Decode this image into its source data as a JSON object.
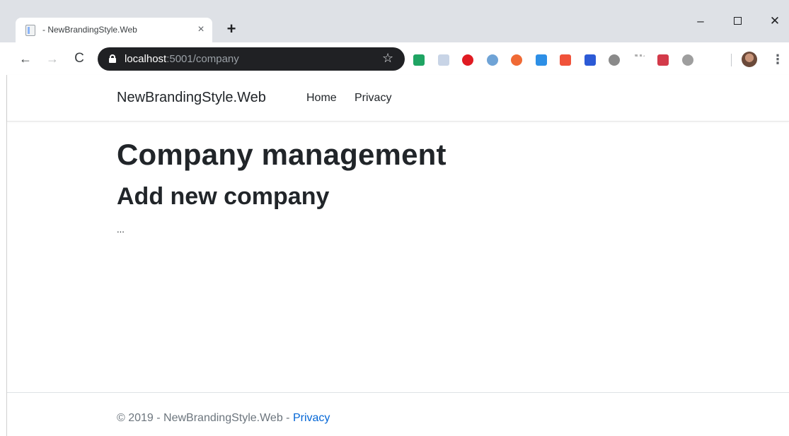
{
  "browser": {
    "tab": {
      "title": "- NewBrandingStyle.Web",
      "close_glyph": "×"
    },
    "new_tab_glyph": "+",
    "window": {
      "minimize_glyph": "–",
      "close_glyph": "✕"
    },
    "nav": {
      "back_glyph": "←",
      "forward_glyph": "→",
      "reload_glyph": "C"
    },
    "address": {
      "host": "localhost",
      "rest": ":5001/company"
    },
    "star_glyph": "☆",
    "menu_glyph": "⋮",
    "extensions": [
      {
        "name": "google-drive-icon",
        "color": "#1fa463"
      },
      {
        "name": "react-devtools-icon",
        "color": "#c8d4e6"
      },
      {
        "name": "opera-icon",
        "color": "#e01b22"
      },
      {
        "name": "edge-icon",
        "color": "#6fa3d6"
      },
      {
        "name": "ublock-icon",
        "color": "#f06a35"
      },
      {
        "name": "window-resizer-icon",
        "color": "#2d8fe6"
      },
      {
        "name": "feedback-icon",
        "color": "#f0523a"
      },
      {
        "name": "bookmark-icon",
        "color": "#2c5ad6"
      },
      {
        "name": "timer-icon",
        "color": "#8a8a8a"
      },
      {
        "name": "dots-icon",
        "color": "#b0b0b0"
      },
      {
        "name": "pocket-icon",
        "color": "#d33a4a"
      },
      {
        "name": "puzzle-icon",
        "color": "#9e9e9e"
      }
    ]
  },
  "site": {
    "brand": "NewBrandingStyle.Web",
    "nav": {
      "home": "Home",
      "privacy": "Privacy"
    }
  },
  "main": {
    "heading": "Company management",
    "subheading": "Add new company",
    "placeholder_text": "..."
  },
  "footer": {
    "copyright": "© 2019 - NewBrandingStyle.Web - ",
    "privacy_link": "Privacy"
  }
}
